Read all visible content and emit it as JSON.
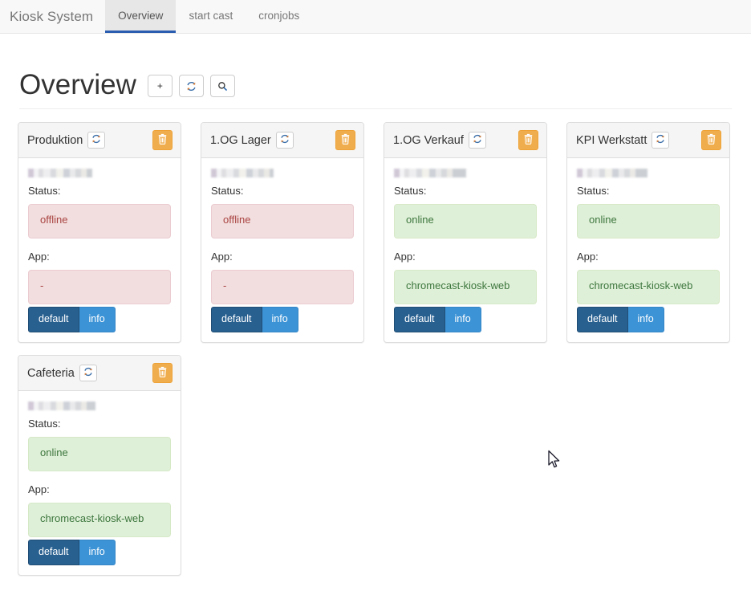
{
  "navbar": {
    "brand": "Kiosk System",
    "tabs": [
      {
        "label": "Overview",
        "active": true
      },
      {
        "label": "start cast",
        "active": false
      },
      {
        "label": "cronjobs",
        "active": false
      }
    ]
  },
  "page": {
    "title": "Overview",
    "toolbar": [
      {
        "name": "add-button",
        "icon": "plus-icon",
        "label": "+"
      },
      {
        "name": "refresh-all-button",
        "icon": "refresh-icon",
        "label": ""
      },
      {
        "name": "search-button",
        "icon": "search-icon",
        "label": ""
      }
    ]
  },
  "labels": {
    "status": "Status:",
    "app": "App:",
    "refresh_icon": "refresh-icon",
    "delete_icon": "trash-icon",
    "default_button": "default",
    "info_button": "info"
  },
  "colors": {
    "warning": "#f0ad4e",
    "danger_bg": "#f2dede",
    "danger_text": "#a94442",
    "success_bg": "#dff0d8",
    "success_text": "#3c763d",
    "primary_active": "#286090",
    "primary": "#3c93d6",
    "tab_active_border": "#2a5db0"
  },
  "cards": [
    {
      "title": "Produktion",
      "host_redacted": true,
      "status": "offline",
      "status_kind": "danger",
      "app": "-",
      "app_kind": "danger",
      "default_label": "default",
      "info_label": "info"
    },
    {
      "title": "1.OG Lager",
      "host_redacted": true,
      "status": "offline",
      "status_kind": "danger",
      "app": "-",
      "app_kind": "danger",
      "default_label": "default",
      "info_label": "info"
    },
    {
      "title": "1.OG Verkauf",
      "host_redacted": true,
      "status": "online",
      "status_kind": "success",
      "app": "chromecast-kiosk-web",
      "app_kind": "success",
      "default_label": "default",
      "info_label": "info"
    },
    {
      "title": "KPI Werkstatt",
      "host_redacted": true,
      "status": "online",
      "status_kind": "success",
      "app": "chromecast-kiosk-web",
      "app_kind": "success",
      "default_label": "default",
      "info_label": "info"
    },
    {
      "title": "Cafeteria",
      "host_redacted": true,
      "status": "online",
      "status_kind": "success",
      "app": "chromecast-kiosk-web",
      "app_kind": "success",
      "default_label": "default",
      "info_label": "info"
    }
  ]
}
